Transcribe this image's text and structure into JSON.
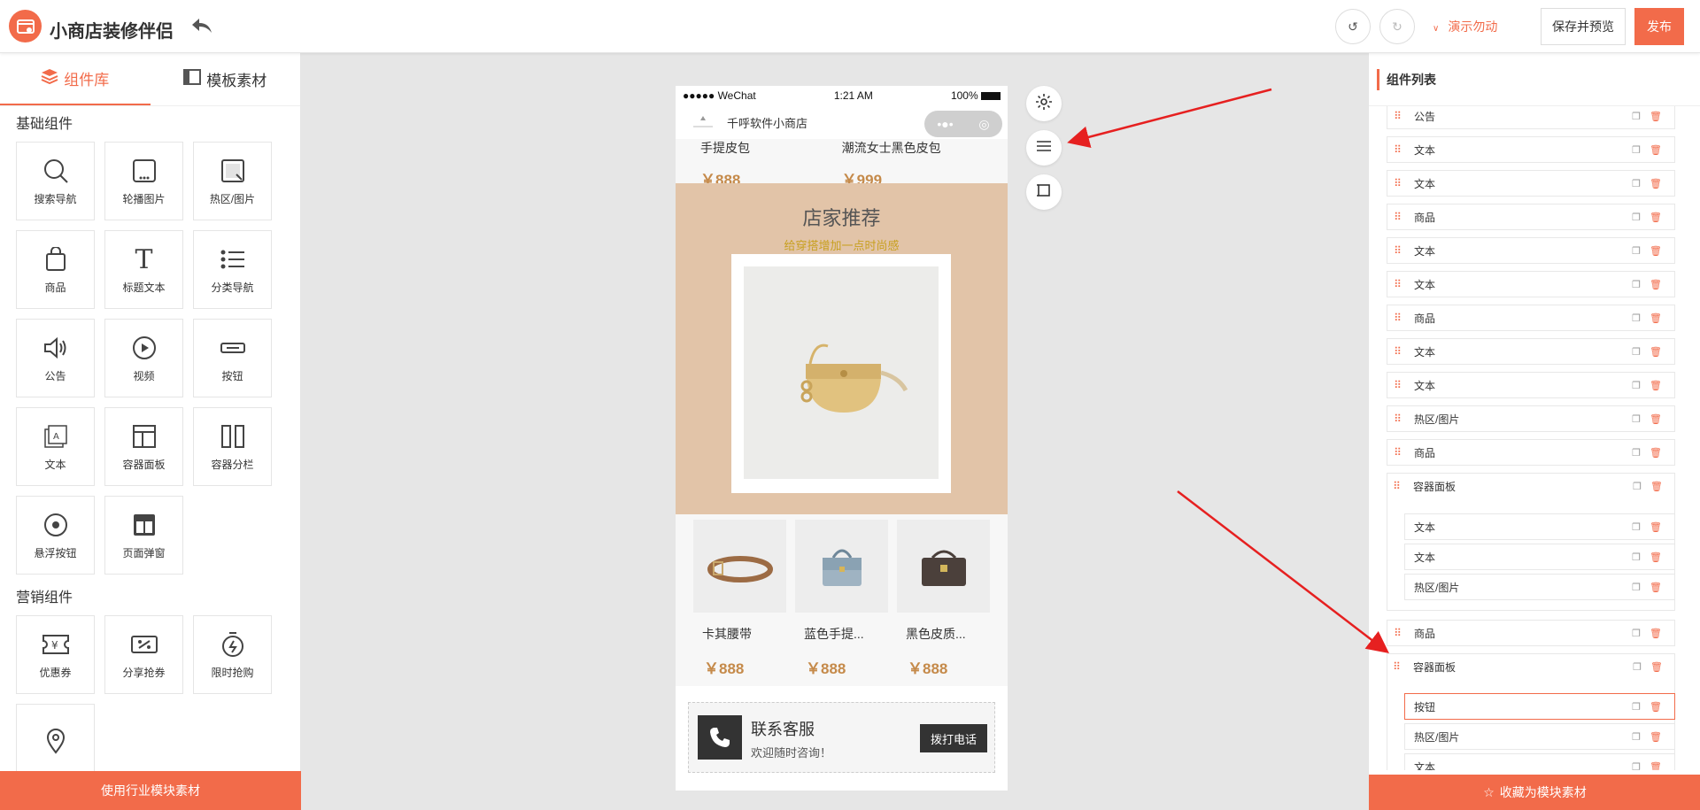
{
  "header": {
    "app_name": "小商店装修伴侣",
    "demo_label": "演示勿动",
    "save_preview": "保存并预览",
    "publish": "发布"
  },
  "left_panel": {
    "tabs": [
      {
        "label": "组件库",
        "active": true
      },
      {
        "label": "模板素材",
        "active": false
      }
    ],
    "sections": [
      {
        "title": "基础组件",
        "items": [
          {
            "label": "搜索导航",
            "icon": "search-icon"
          },
          {
            "label": "轮播图片",
            "icon": "carousel-icon"
          },
          {
            "label": "热区/图片",
            "icon": "hotspot-icon"
          },
          {
            "label": "商品",
            "icon": "bag-icon"
          },
          {
            "label": "标题文本",
            "icon": "title-text-icon"
          },
          {
            "label": "分类导航",
            "icon": "list-icon"
          },
          {
            "label": "公告",
            "icon": "speaker-icon"
          },
          {
            "label": "视频",
            "icon": "play-icon"
          },
          {
            "label": "按钮",
            "icon": "button-icon"
          },
          {
            "label": "文本",
            "icon": "text-icon"
          },
          {
            "label": "容器面板",
            "icon": "panel-icon"
          },
          {
            "label": "容器分栏",
            "icon": "columns-icon"
          },
          {
            "label": "悬浮按钮",
            "icon": "float-button-icon"
          },
          {
            "label": "页面弹窗",
            "icon": "popup-icon"
          }
        ]
      },
      {
        "title": "营销组件",
        "items": [
          {
            "label": "优惠券",
            "icon": "coupon-icon"
          },
          {
            "label": "分享抢券",
            "icon": "share-coupon-icon"
          },
          {
            "label": "限时抢购",
            "icon": "timer-icon"
          },
          {
            "label": "",
            "icon": "location-icon"
          }
        ]
      }
    ],
    "footer": "使用行业模块素材"
  },
  "phone": {
    "status": {
      "carrier": "●●●●● WeChat",
      "time": "1:21 AM",
      "battery": "100%"
    },
    "shop_name": "千呼软件小商店",
    "top_products": [
      {
        "name": "手提皮包",
        "price": "￥888"
      },
      {
        "name": "潮流女士黑色皮包",
        "price": "￥999"
      }
    ],
    "recommend": {
      "title": "店家推荐",
      "subtitle": "给穿搭增加一点时尚感"
    },
    "trio": [
      {
        "name": "卡其腰带",
        "price": "￥888"
      },
      {
        "name": "蓝色手提...",
        "price": "￥888"
      },
      {
        "name": "黑色皮质...",
        "price": "￥888"
      }
    ],
    "service": {
      "title": "联系客服",
      "subtitle": "欢迎随时咨询！",
      "call": "拨打电话"
    }
  },
  "right_panel": {
    "title": "组件列表",
    "items": [
      "公告",
      "文本",
      "文本",
      "商品",
      "文本",
      "文本",
      "商品",
      "文本",
      "文本",
      "热区/图片",
      "商品",
      "容器面板"
    ],
    "group1_children": [
      "文本",
      "文本",
      "热区/图片"
    ],
    "after_group1": "商品",
    "group2": "容器面板",
    "group2_children": [
      "按钮",
      "热区/图片",
      "文本"
    ],
    "footer": "收藏为模块素材"
  },
  "colors": {
    "accent": "#f26b4a",
    "price": "#c58a4a",
    "recommend_bg": "#e2c4a8"
  }
}
